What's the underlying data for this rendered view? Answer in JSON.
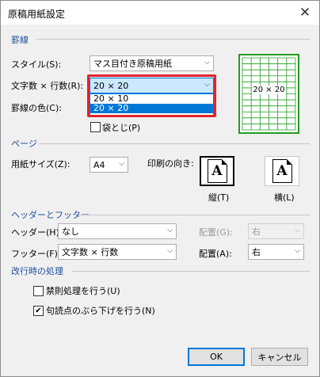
{
  "window": {
    "title": "原稿用紙設定",
    "close_glyph": "✕"
  },
  "lines_section": {
    "title": "罫線",
    "style_label": "スタイル(S):",
    "style_value": "マス目付き原稿用紙",
    "chars_label": "文字数 × 行数(R):",
    "chars_value": "20 × 20",
    "chars_options": [
      "20 × 10",
      "20 × 20"
    ],
    "color_label": "罫線の色(C):",
    "fold_label": "袋とじ(P)",
    "preview_text": "20 × 20"
  },
  "page_section": {
    "title": "ページ",
    "paper_label": "用紙サイズ(Z):",
    "paper_value": "A4",
    "orientation_label": "印刷の向き:",
    "portrait_label": "縦(T)",
    "landscape_label": "横(L)",
    "icon_letter": "A"
  },
  "header_section": {
    "title": "ヘッダーとフッター",
    "header_label": "ヘッダー(H):",
    "header_value": "なし",
    "header_pos_label": "配置(G):",
    "header_pos_value": "右",
    "footer_label": "フッター(F):",
    "footer_value": "文字数 × 行数",
    "footer_pos_label": "配置(A):",
    "footer_pos_value": "右"
  },
  "wrap_section": {
    "title": "改行時の処理",
    "kinsoku_label": "禁則処理を行う(U)",
    "kinsoku_checked": false,
    "hang_label": "句読点のぶら下げを行う(N)",
    "hang_checked": true
  },
  "buttons": {
    "ok": "OK",
    "cancel": "キャンセル"
  },
  "colors": {
    "accent": "#0078d7",
    "highlight_frame": "#e0242c",
    "preview_grid": "#1f9d1f",
    "section_title": "#1f4e9c"
  }
}
